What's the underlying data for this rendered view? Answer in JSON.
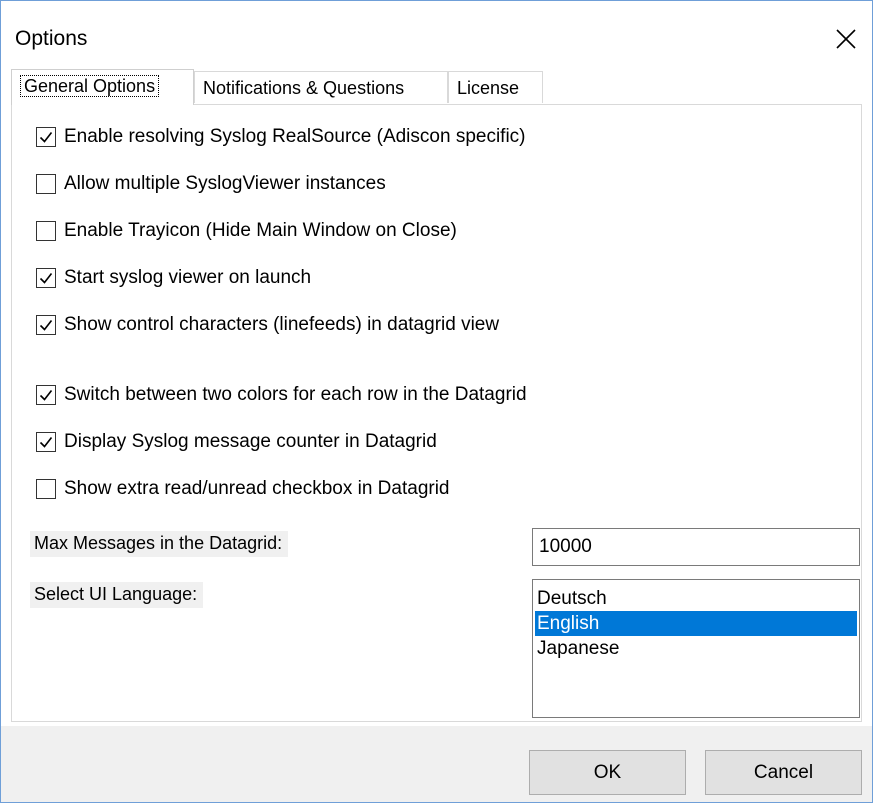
{
  "window": {
    "title": "Options"
  },
  "tabs": [
    {
      "label": "General Options",
      "active": true
    },
    {
      "label": "Notifications & Questions",
      "active": false
    },
    {
      "label": "License",
      "active": false
    }
  ],
  "options": [
    {
      "label": "Enable resolving Syslog RealSource (Adiscon specific)",
      "checked": true
    },
    {
      "label": "Allow multiple SyslogViewer instances",
      "checked": false
    },
    {
      "label": "Enable Trayicon (Hide Main Window on Close)",
      "checked": false
    },
    {
      "label": "Start syslog viewer on launch",
      "checked": true
    },
    {
      "label": "Show control characters (linefeeds) in datagrid view",
      "checked": true
    },
    {
      "label": "Switch between two colors for each row in the Datagrid",
      "checked": true
    },
    {
      "label": "Display Syslog message counter in Datagrid",
      "checked": true
    },
    {
      "label": "Show extra read/unread checkbox in Datagrid",
      "checked": false
    }
  ],
  "max_messages": {
    "label": "Max Messages in the Datagrid:",
    "value": "10000"
  },
  "language": {
    "label": "Select UI Language:",
    "options": [
      "Deutsch",
      "English",
      "Japanese"
    ],
    "selected": "English"
  },
  "buttons": {
    "ok_label": "OK",
    "cancel_label": "Cancel"
  },
  "colors": {
    "selection": "#0078d7",
    "window_border": "#6f9fd8",
    "footer_bg": "#f0f0f0"
  }
}
